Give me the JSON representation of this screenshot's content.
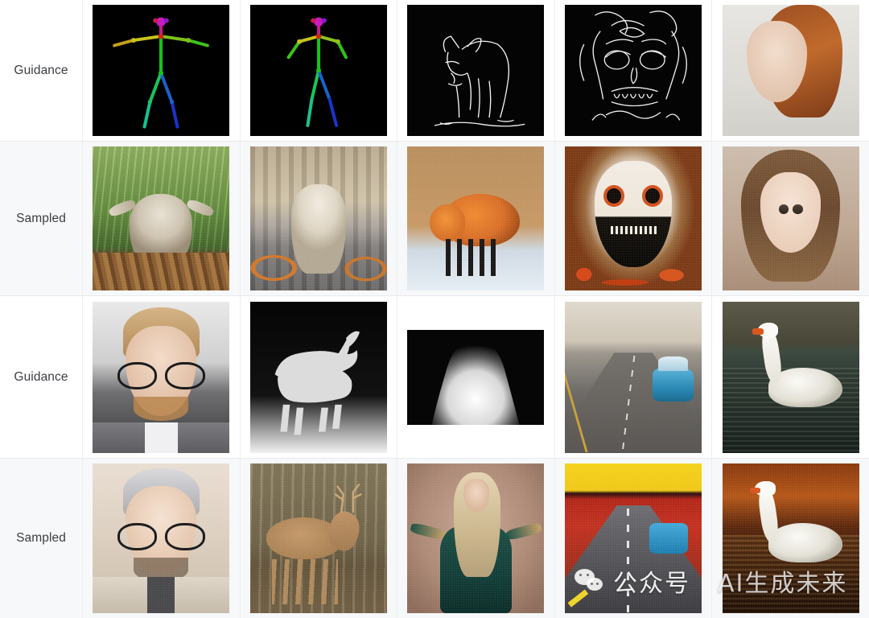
{
  "table": {
    "row_label_column_header": "",
    "rows": [
      {
        "label": "Guidance",
        "kind": "guidance",
        "cells": [
          {
            "name": "openpose-skeleton-star-pose",
            "caption": "OpenPose skeleton, arms outstretched",
            "type": "pose"
          },
          {
            "name": "openpose-skeleton-standing-pose",
            "caption": "OpenPose skeleton, standing figure",
            "type": "pose"
          },
          {
            "name": "canny-edge-fox",
            "caption": "Canny edge map of a fox",
            "type": "canny"
          },
          {
            "name": "canny-edge-skull-face",
            "caption": "Canny edge map of a sugar-skull face",
            "type": "canny"
          },
          {
            "name": "photo-red-haired-woman",
            "caption": "Photo of a red-haired woman",
            "type": "photo"
          }
        ]
      },
      {
        "label": "Sampled",
        "kind": "sampled",
        "cells": [
          {
            "name": "sampled-bear-bamboo-forest",
            "caption": "Bear standing on a log in a bamboo forest",
            "type": "generated"
          },
          {
            "name": "sampled-polar-bear-city-street",
            "caption": "Polar bear walking on a city street",
            "type": "generated"
          },
          {
            "name": "sampled-red-fox-snow",
            "caption": "Red fox walking on snow",
            "type": "generated"
          },
          {
            "name": "sampled-sugar-skull-makeup",
            "caption": "Woman with sugar-skull makeup and orange flowers",
            "type": "generated"
          },
          {
            "name": "sampled-anime-portrait",
            "caption": "Anime-style portrait of a woman",
            "type": "generated"
          }
        ]
      },
      {
        "label": "Guidance",
        "kind": "guidance",
        "cells": [
          {
            "name": "photo-man-with-glasses",
            "caption": "Photo of a blond man wearing glasses",
            "type": "photo"
          },
          {
            "name": "depth-map-deer",
            "caption": "Depth map of a deer",
            "type": "depth"
          },
          {
            "name": "depth-map-person",
            "caption": "Depth map of a standing person",
            "type": "depth"
          },
          {
            "name": "photo-desert-road-blue-car",
            "caption": "Photo of a blue car on a desert road",
            "type": "photo"
          },
          {
            "name": "photo-swan-on-water",
            "caption": "Photo of a swan on water",
            "type": "photo"
          }
        ]
      },
      {
        "label": "Sampled",
        "kind": "sampled",
        "cells": [
          {
            "name": "sampled-illustrated-man-glasses",
            "caption": "Illustrated man with glasses in a light suit",
            "type": "generated"
          },
          {
            "name": "sampled-deer-in-forest",
            "caption": "Deer with antlers in a misty forest",
            "type": "generated"
          },
          {
            "name": "sampled-woman-green-dress",
            "caption": "Woman with long blonde hair in a green dress",
            "type": "generated"
          },
          {
            "name": "sampled-stylized-road-scene",
            "caption": "Stylized road scene with yellow sky and blue car",
            "type": "generated"
          },
          {
            "name": "sampled-swan-autumn",
            "caption": "Swan on water with autumn foliage",
            "type": "generated"
          }
        ]
      }
    ]
  },
  "watermark": {
    "logo": "wechat-logo",
    "account_label": "公众号",
    "account_name": "AI生成未来"
  },
  "colors": {
    "page_background": "#ffffff",
    "alt_row_background": "#f7f8f9",
    "divider": "#eceef0",
    "label_text": "#3b3e42"
  }
}
